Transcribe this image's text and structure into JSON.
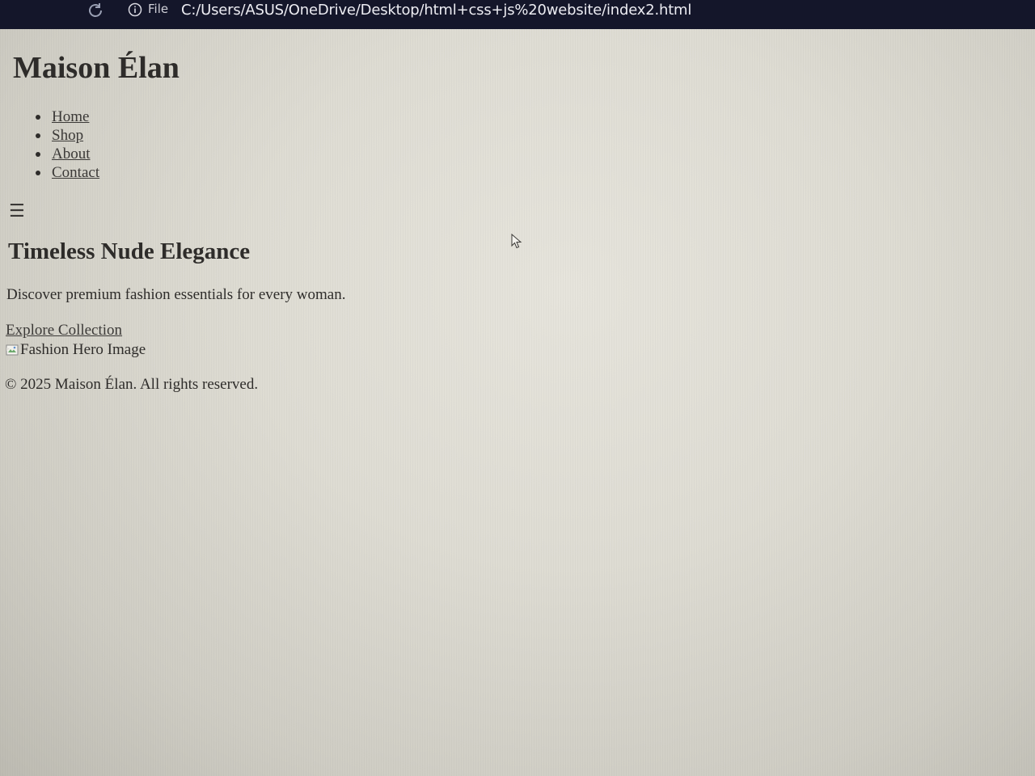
{
  "browser": {
    "file_label": "File",
    "url": "C:/Users/ASUS/OneDrive/Desktop/html+css+js%20website/index2.html"
  },
  "site": {
    "title": "Maison Élan",
    "nav": [
      "Home",
      "Shop",
      "About",
      "Contact"
    ],
    "menu_toggle": "☰"
  },
  "hero": {
    "heading": "Timeless Nude Elegance",
    "text": "Discover premium fashion essentials for every woman.",
    "cta": "Explore Collection",
    "image_alt": "Fashion Hero Image"
  },
  "footer": {
    "text": "© 2025 Maison Élan. All rights reserved."
  },
  "icons": {
    "reload": "reload-icon",
    "info": "info-icon",
    "broken_image": "broken-image-icon",
    "cursor": "mouse-cursor-icon"
  },
  "colors": {
    "browser_bar": "#14162a",
    "page_text": "#2e2c2a"
  }
}
